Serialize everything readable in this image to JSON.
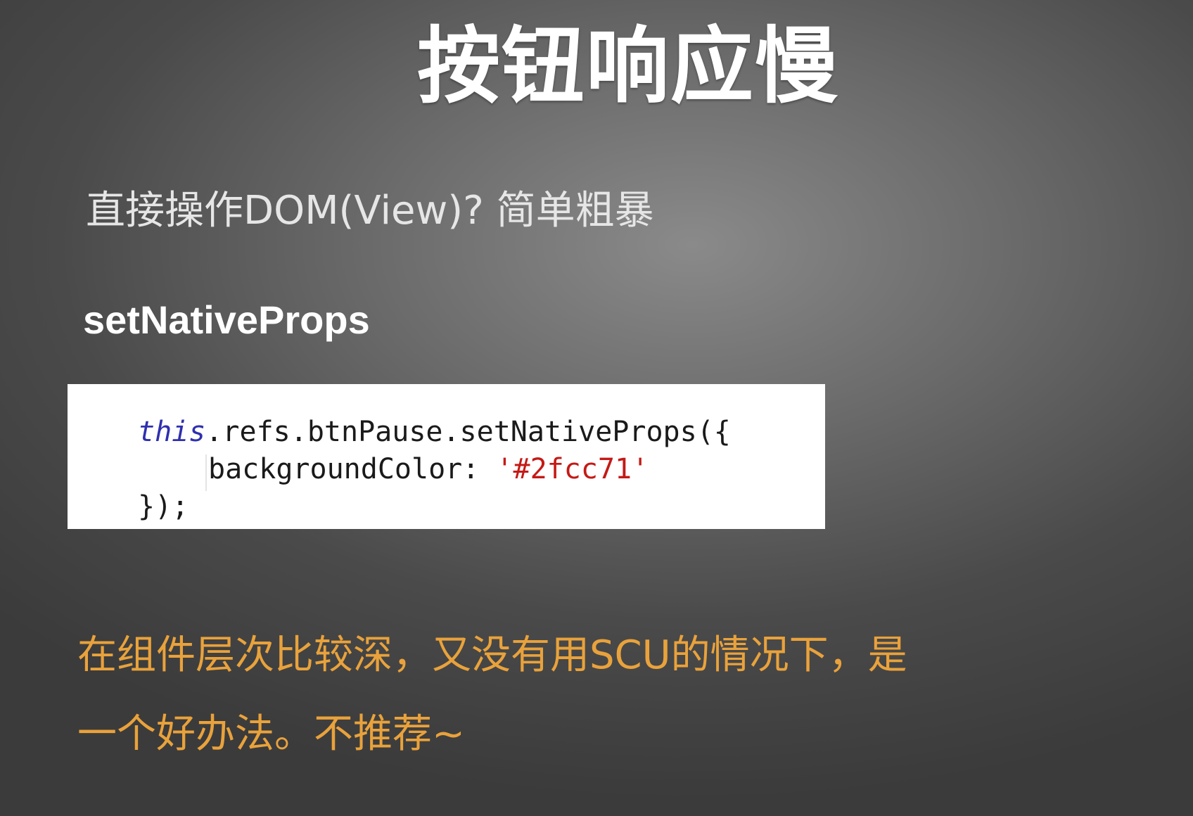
{
  "slide": {
    "title": "按钮响应慢",
    "subtitle": "直接操作DOM(View)? 简单粗暴",
    "method_label": "setNativeProps",
    "code": {
      "line1_keyword": "this",
      "line1_rest": ".refs.btnPause.setNativeProps({",
      "line2_prop": "backgroundColor: ",
      "line2_value": "'#2fcc71'",
      "line3": "});"
    },
    "note": {
      "line1": "在组件层次比较深，又没有用SCU的情况下，是",
      "line2": "一个好办法。不推荐~"
    },
    "colors": {
      "note_text": "#e9a23b",
      "keyword": "#2f2fb0",
      "string": "#c41a16"
    }
  }
}
